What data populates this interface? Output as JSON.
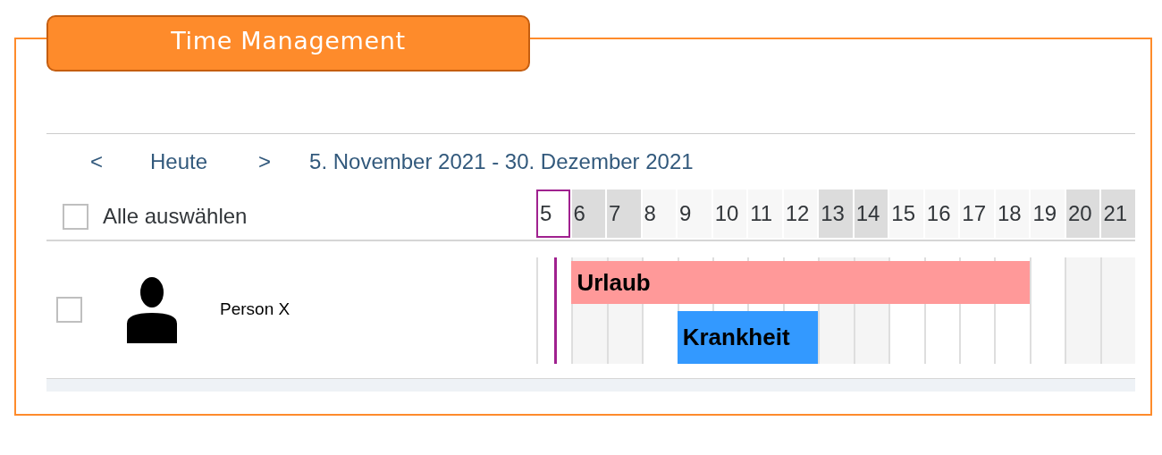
{
  "title": "Time Management",
  "nav": {
    "prev": "<",
    "today": "Heute",
    "next": ">",
    "range": "5. November 2021 - 30. Dezember 2021"
  },
  "select_all": {
    "label": "Alle auswählen",
    "checked": false
  },
  "days": [
    {
      "label": "5",
      "weekend": false,
      "today": true
    },
    {
      "label": "6",
      "weekend": true,
      "today": false
    },
    {
      "label": "7",
      "weekend": true,
      "today": false
    },
    {
      "label": "8",
      "weekend": false,
      "today": false
    },
    {
      "label": "9",
      "weekend": false,
      "today": false
    },
    {
      "label": "10",
      "weekend": false,
      "today": false
    },
    {
      "label": "11",
      "weekend": false,
      "today": false
    },
    {
      "label": "12",
      "weekend": false,
      "today": false
    },
    {
      "label": "13",
      "weekend": true,
      "today": false
    },
    {
      "label": "14",
      "weekend": true,
      "today": false
    },
    {
      "label": "15",
      "weekend": false,
      "today": false
    },
    {
      "label": "16",
      "weekend": false,
      "today": false
    },
    {
      "label": "17",
      "weekend": false,
      "today": false
    },
    {
      "label": "18",
      "weekend": false,
      "today": false
    },
    {
      "label": "19",
      "weekend": false,
      "today": false
    },
    {
      "label": "20",
      "weekend": true,
      "today": false
    },
    {
      "label": "21",
      "weekend": true,
      "today": false
    }
  ],
  "rows": [
    {
      "name": "Person X",
      "checked": false,
      "absences": [
        {
          "label": "Urlaub",
          "color": "#ff9999",
          "covers": [
            false,
            true,
            true,
            true,
            true,
            true,
            true,
            true,
            true,
            true,
            true,
            true,
            true,
            true,
            false,
            false,
            false
          ]
        },
        {
          "label": "Krankheit",
          "color": "#3399ff",
          "covers": [
            false,
            false,
            false,
            false,
            true,
            true,
            true,
            true,
            false,
            false,
            false,
            false,
            false,
            false,
            false,
            false,
            false
          ]
        }
      ]
    }
  ]
}
